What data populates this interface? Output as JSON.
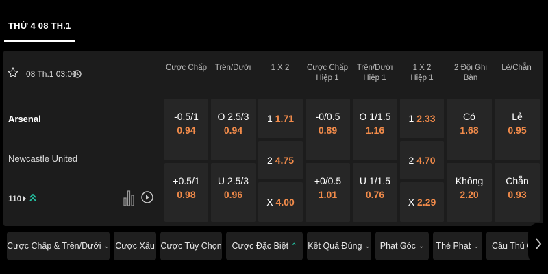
{
  "date_header": {
    "title": "THỨ 4 08 TH.1"
  },
  "match": {
    "time": "08 Th.1 03:00",
    "home_team": "Arsenal",
    "away_team": "Newcastle United",
    "more_markets_count": "110"
  },
  "columns": [
    {
      "line1": "Cược Chấp",
      "line2": ""
    },
    {
      "line1": "Trên/Dưới",
      "line2": ""
    },
    {
      "line1": "1 X 2",
      "line2": ""
    },
    {
      "line1": "Cược Chấp",
      "line2": "Hiệp 1"
    },
    {
      "line1": "Trên/Dưới",
      "line2": "Hiệp 1"
    },
    {
      "line1": "1 X 2",
      "line2": "Hiệp 1"
    },
    {
      "line1": "2 Đội Ghi Bàn",
      "line2": ""
    },
    {
      "line1": "Lẻ/Chẵn",
      "line2": ""
    }
  ],
  "odds": {
    "handicap": [
      {
        "line": "-0.5/1",
        "odd": "0.94"
      },
      {
        "line": "+0.5/1",
        "odd": "0.98"
      }
    ],
    "over_under": [
      {
        "line": "O 2.5/3",
        "odd": "0.94"
      },
      {
        "line": "U 2.5/3",
        "odd": "0.96"
      }
    ],
    "one_x_two": [
      {
        "line": "1",
        "odd": "1.71"
      },
      {
        "line": "2",
        "odd": "4.75"
      },
      {
        "line": "X",
        "odd": "4.00"
      }
    ],
    "handicap_h1": [
      {
        "line": "-0/0.5",
        "odd": "0.89"
      },
      {
        "line": "+0/0.5",
        "odd": "1.01"
      }
    ],
    "over_under_h1": [
      {
        "line": "O 1/1.5",
        "odd": "1.16"
      },
      {
        "line": "U 1/1.5",
        "odd": "0.76"
      }
    ],
    "one_x_two_h1": [
      {
        "line": "1",
        "odd": "2.33"
      },
      {
        "line": "2",
        "odd": "4.70"
      },
      {
        "line": "X",
        "odd": "2.29"
      }
    ],
    "both_score": [
      {
        "line": "Có",
        "odd": "1.68"
      },
      {
        "line": "Không",
        "odd": "2.20"
      }
    ],
    "odd_even": [
      {
        "line": "Lẻ",
        "odd": "0.95"
      },
      {
        "line": "Chẵn",
        "odd": "0.93"
      }
    ]
  },
  "tabs": [
    {
      "label": "Cược Chấp & Trên/Dưới",
      "chevron": "chevron-down"
    },
    {
      "label": "Cược Xâu",
      "chevron": ""
    },
    {
      "label": "Cược Tùy Chọn",
      "chevron": ""
    },
    {
      "label": "Cược Đặc Biệt",
      "chevron": "double-chevron-up"
    },
    {
      "label": "Kết Quả Đúng",
      "chevron": "chevron-down"
    },
    {
      "label": "Phạt Góc",
      "chevron": "chevron-down"
    },
    {
      "label": "Thẻ Phạt",
      "chevron": "chevron-down"
    },
    {
      "label": "Cầu Thủ Ghi",
      "chevron": ""
    }
  ],
  "colors": {
    "odd_value": "#f28b4a",
    "accent_teal": "#22c7a6",
    "cell_bg": "#262626",
    "panel_bg": "#1c1c1c"
  }
}
